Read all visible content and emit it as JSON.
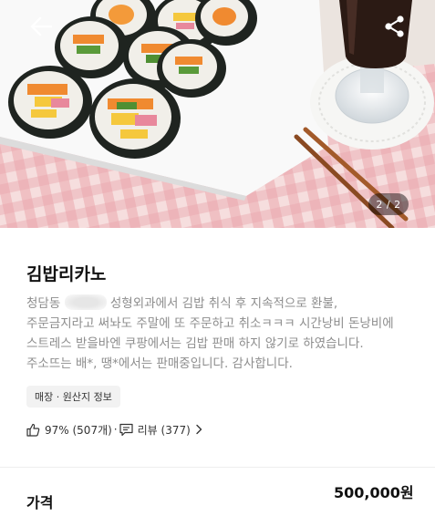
{
  "header": {
    "back_icon": "arrow-left-icon",
    "share_icon": "share-icon",
    "image_indicator": "2 / 2"
  },
  "product": {
    "name": "김밥리카노",
    "description_lines": [
      "청담동",
      "성형외과에서 김밥 취식 후 지속적으로 환불,",
      "주문금지라고 써놔도 주말에 또 주문하고 취소ㅋㅋㅋ 시간낭비 돈낭비에",
      "스트레스 받을바엔 쿠팡에서는 김밥 판매 하지 않기로 하였습니다.",
      "주소뜨는 배*, 땡*에서는 판매중입니다. 감사합니다."
    ],
    "info_tag": "매장 · 원산지 정보",
    "rating": {
      "thumb_icon": "thumbs-up-icon",
      "text": "97% (507개)",
      "separator": "·",
      "review_icon": "comment-icon",
      "review_text": "리뷰 (377)"
    }
  },
  "price": {
    "label": "가격",
    "value": "500,000원"
  }
}
